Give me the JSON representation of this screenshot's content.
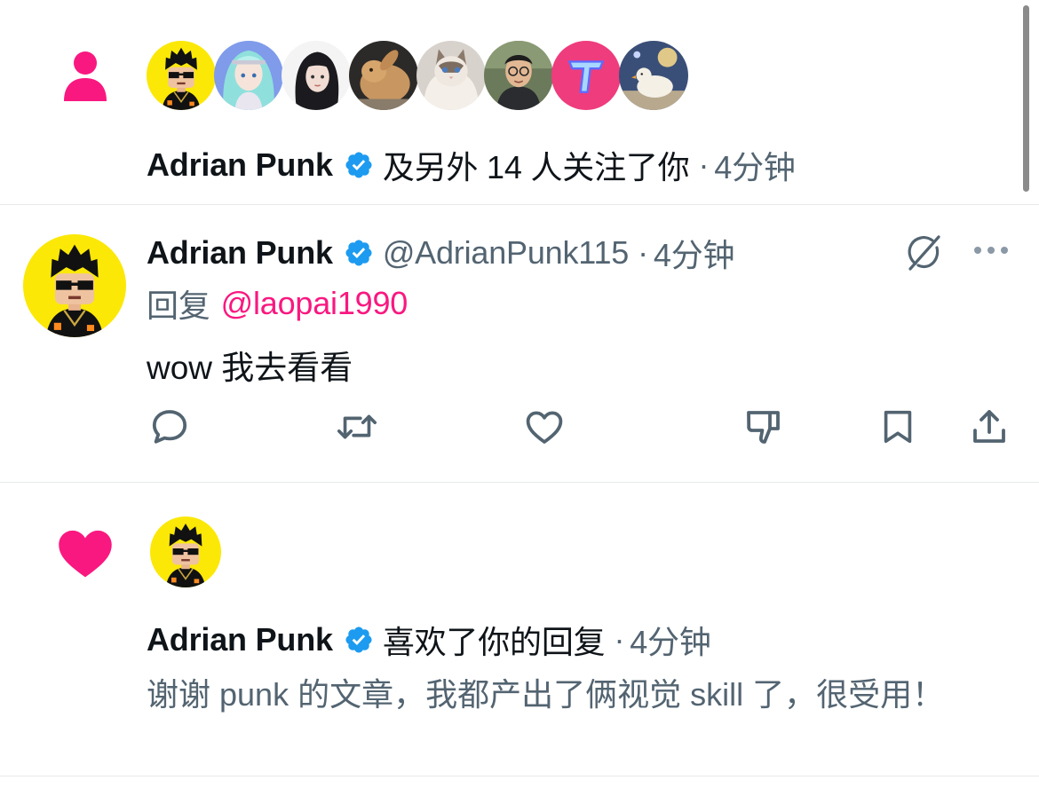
{
  "colors": {
    "accent_pink": "#f91880",
    "verified_blue": "#1d9bf0",
    "text_primary": "#0f1419",
    "text_secondary": "#536471"
  },
  "follow_notification": {
    "icon": "person-icon",
    "follower_avatars": [
      "pixel-punk-avatar",
      "anime-girl-avatar",
      "girl-portrait-avatar",
      "rabbit-avatar",
      "ragdoll-cat-avatar",
      "man-with-glasses-avatar",
      "pink-t-logo-avatar",
      "duck-in-space-avatar"
    ],
    "actor_name": "Adrian Punk",
    "action_text": "及另外 14 人关注了你",
    "separator": "·",
    "time": "4分钟"
  },
  "reply_tweet": {
    "avatar": "pixel-punk-avatar",
    "author_name": "Adrian Punk",
    "handle": "@AdrianPunk115",
    "separator": "·",
    "time": "4分钟",
    "reply_prefix": "回复",
    "reply_to": "@laopai1990",
    "text": "wow 我去看看",
    "top_actions": [
      "grok-icon",
      "more-icon"
    ],
    "actions": [
      "reply-icon",
      "retweet-icon",
      "like-icon",
      "dislike-icon",
      "bookmark-icon",
      "share-icon"
    ]
  },
  "like_notification": {
    "icon": "heart-icon",
    "avatar": "pixel-punk-avatar",
    "actor_name": "Adrian Punk",
    "action_text": "喜欢了你的回复",
    "separator": "·",
    "time": "4分钟",
    "liked_text": "谢谢 punk 的文章，我都产出了俩视觉 skill 了，很受用！"
  }
}
